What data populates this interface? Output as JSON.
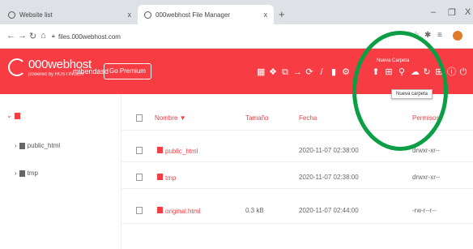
{
  "browser": {
    "tabs": [
      {
        "title": "Website list",
        "close": "x"
      },
      {
        "title": "000webhost File Manager",
        "close": "x"
      }
    ],
    "new_tab": "+",
    "window_controls": [
      "–",
      "❐",
      "X"
    ],
    "url": "files.000webhost.com"
  },
  "header": {
    "logo_brand": "000webhost",
    "logo_powered": "powered by HOSTINGER",
    "site_name": "mibendasd",
    "premium_button": "Go Premium",
    "toolbar_top_label": "Nueva Carpeta",
    "tooltip": "Nueva carpeta"
  },
  "sidebar": {
    "root_caret": "⌄",
    "items": [
      {
        "label": "public_html"
      },
      {
        "label": "tmp"
      }
    ]
  },
  "table": {
    "columns": [
      "Nombre ▼",
      "Tamaño",
      "Fecha",
      "Permisos"
    ],
    "rows": [
      {
        "name": "public_html",
        "size": "",
        "date": "2020-11-07 02:38:00",
        "perms": "drwxr-xr--"
      },
      {
        "name": "tmp",
        "size": "",
        "date": "2020-11-07 02:38:00",
        "perms": "drwxr-xr--"
      },
      {
        "name": "original.html",
        "size": "0.3 kB",
        "date": "2020-11-07 02:44:00",
        "perms": "-rw-r--r--"
      }
    ]
  },
  "colors": {
    "accent": "#f73c44",
    "annotation": "#0a9f45"
  }
}
